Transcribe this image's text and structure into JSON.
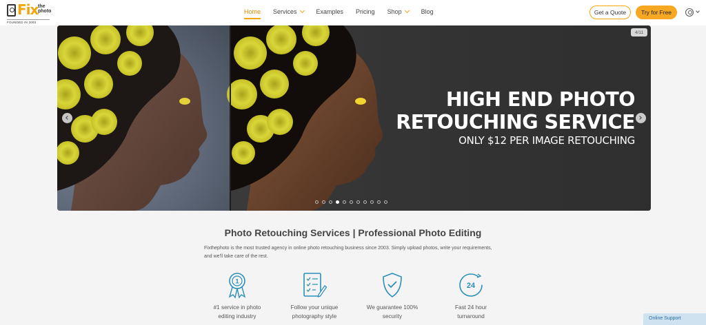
{
  "header": {
    "logo": {
      "brand": "Fix",
      "sub": "the photo",
      "tagline": "FOUNDED IN 2003"
    },
    "nav": [
      {
        "label": "Home",
        "active": true
      },
      {
        "label": "Services",
        "dropdown": true
      },
      {
        "label": "Examples"
      },
      {
        "label": "Pricing"
      },
      {
        "label": "Shop",
        "dropdown": true
      },
      {
        "label": "Blog"
      }
    ],
    "quote_label": "Get a Quote",
    "try_label": "Try for Free",
    "user_icon": "user-icon"
  },
  "hero": {
    "counter": "4/11",
    "title_line1": "HIGH END PHOTO",
    "title_line2": "RETOUCHING SERVICE",
    "subtitle": "ONLY $12 PER IMAGE RETOUCHING",
    "slides_total": 11,
    "active_slide": 4
  },
  "intro": {
    "title": "Photo Retouching Services | Professional Photo Editing",
    "description": "Fixthephoto is the most trusted agency in online photo retouching business since 2003. Simply upload photos, write your requirements, and we'll take care of the rest."
  },
  "features": [
    {
      "icon": "award-ribbon-icon",
      "line1": "#1 service in photo",
      "line2": "editing industry"
    },
    {
      "icon": "checklist-pencil-icon",
      "line1": "Follow your unique",
      "line2": "photography style"
    },
    {
      "icon": "shield-check-icon",
      "line1": "We guarantee 100%",
      "line2": "security"
    },
    {
      "icon": "clock-24-icon",
      "line1": "Fast 24 hour",
      "line2": "turnaround"
    }
  ],
  "support_label": "Online Support",
  "colors": {
    "accent": "#f2a60c",
    "icon_blue": "#2a8fb8",
    "hero_bg": "#2e2e2e"
  }
}
